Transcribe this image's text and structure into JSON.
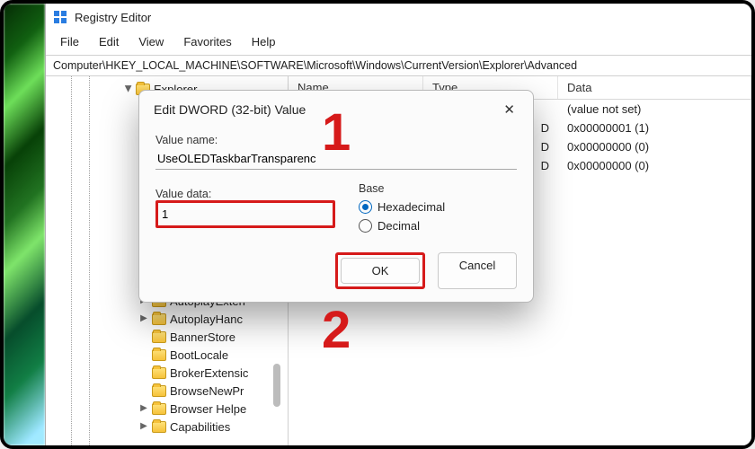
{
  "window": {
    "title": "Registry Editor",
    "address": "Computer\\HKEY_LOCAL_MACHINE\\SOFTWARE\\Microsoft\\Windows\\CurrentVersion\\Explorer\\Advanced"
  },
  "menu": {
    "file": "File",
    "edit": "Edit",
    "view": "View",
    "favorites": "Favorites",
    "help": "Help"
  },
  "tree": {
    "root": "Explorer",
    "children": [
      "AutoplayExten",
      "AutoplayHanc",
      "BannerStore",
      "BootLocale",
      "BrokerExtensic",
      "BrowseNewPr",
      "Browser Helpe",
      "Capabilities"
    ]
  },
  "list": {
    "headers": {
      "name": "Name",
      "type": "Type",
      "data": "Data"
    },
    "rows": [
      {
        "name": "",
        "type": "",
        "data": "(value not set)"
      },
      {
        "name": "",
        "type": "D",
        "data": "0x00000001 (1)"
      },
      {
        "name": "",
        "type": "D",
        "data": "0x00000000 (0)"
      },
      {
        "name": "",
        "type": "D",
        "data": "0x00000000 (0)"
      }
    ]
  },
  "dialog": {
    "title": "Edit DWORD (32-bit) Value",
    "value_name_label": "Value name:",
    "value_name": "UseOLEDTaskbarTransparenc",
    "value_data_label": "Value data:",
    "value_data": "1",
    "base_label": "Base",
    "radio_hex": "Hexadecimal",
    "radio_dec": "Decimal",
    "ok": "OK",
    "cancel": "Cancel"
  },
  "annotations": {
    "one": "1",
    "two": "2"
  },
  "colors": {
    "highlight": "#d61a1a",
    "accent": "#0067c0"
  }
}
